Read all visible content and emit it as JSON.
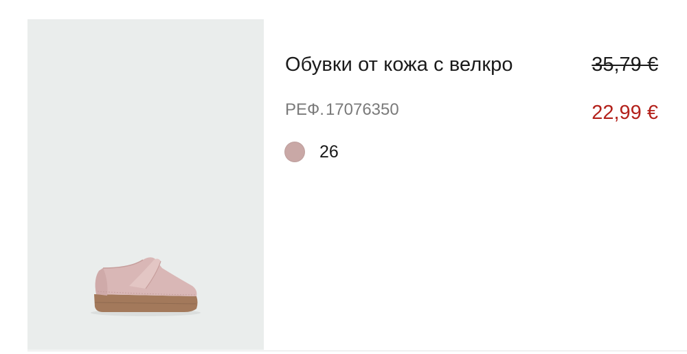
{
  "product": {
    "title": "Обувки от кожа с велкро",
    "old_price": "35,79 €",
    "sale_price": "22,99 €",
    "ref_label": "РЕФ.",
    "ref_number": "17076350",
    "size": "26"
  },
  "colors": {
    "image_background": "#eaedec",
    "swatch": "#c9a8a6",
    "sale_price": "#b3211b",
    "ref_text": "#7a7a7a"
  },
  "icons": {
    "product_image": "pink-velcro-shoe-image",
    "swatch": "color-swatch-circle"
  }
}
